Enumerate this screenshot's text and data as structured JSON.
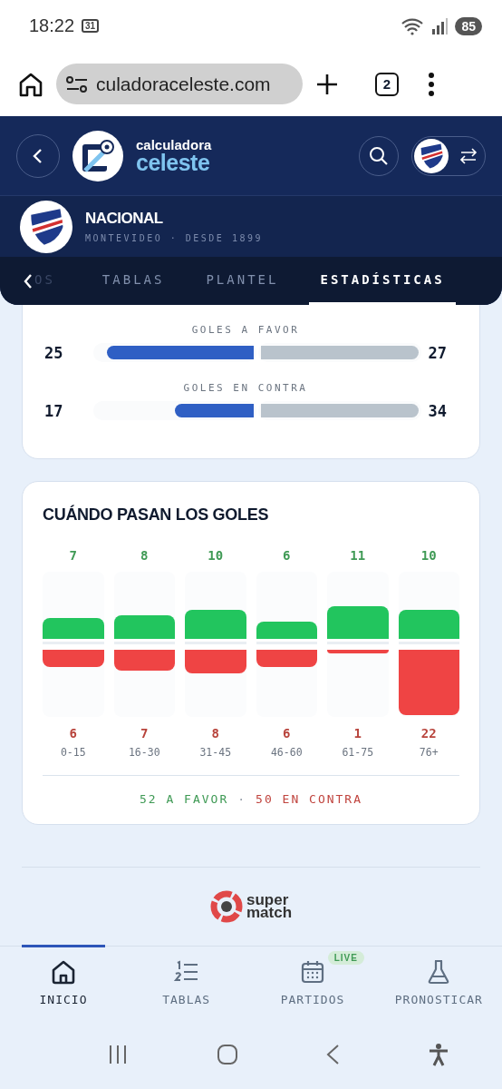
{
  "status_bar": {
    "time": "18:22",
    "calendar_day": "31",
    "battery": "85"
  },
  "browser": {
    "url": "culadoraceleste.com",
    "tab_count": "2"
  },
  "app_header": {
    "logo_top": "calculadora",
    "logo_bottom": "celeste"
  },
  "team": {
    "name": "NACIONAL",
    "subtitle": "MONTEVIDEO · DESDE 1899"
  },
  "tabs": [
    {
      "label": "OS",
      "selected": false
    },
    {
      "label": "TABLAS",
      "selected": false
    },
    {
      "label": "PLANTEL",
      "selected": false
    },
    {
      "label": "ESTADÍSTICAS",
      "selected": true
    }
  ],
  "comparisons": [
    {
      "label": "GOLES A FAVOR",
      "left": {
        "value": "25",
        "level": 0.93
      },
      "right": {
        "value": "27",
        "level": 1
      }
    },
    {
      "label": "GOLES EN CONTRA",
      "left": {
        "value": "17",
        "level": 0.5
      },
      "right": {
        "value": "34",
        "level": 1
      }
    }
  ],
  "goals_timing": {
    "title": "CUÁNDO PASAN LOS GOLES",
    "periods": [
      {
        "range": "0-15",
        "goals_for": {
          "value": "7",
          "level": 0.32
        },
        "goals_against": {
          "value": "6",
          "level": 0.27
        }
      },
      {
        "range": "16-30",
        "goals_for": {
          "value": "8",
          "level": 0.36
        },
        "goals_against": {
          "value": "7",
          "level": 0.32
        }
      },
      {
        "range": "31-45",
        "goals_for": {
          "value": "10",
          "level": 0.45
        },
        "goals_against": {
          "value": "8",
          "level": 0.36
        }
      },
      {
        "range": "46-60",
        "goals_for": {
          "value": "6",
          "level": 0.27
        },
        "goals_against": {
          "value": "6",
          "level": 0.27
        }
      },
      {
        "range": "61-75",
        "goals_for": {
          "value": "11",
          "level": 0.5
        },
        "goals_against": {
          "value": "1",
          "level": 0.05
        }
      },
      {
        "range": "76+",
        "goals_for": {
          "value": "10",
          "level": 0.45
        },
        "goals_against": {
          "value": "22",
          "level": 1
        }
      }
    ],
    "summary": [
      {
        "text": "52 A FAVOR",
        "color": "#3f9a55"
      },
      {
        "text": "50 EN CONTRA",
        "color": "#c0443e"
      }
    ],
    "separator": "·"
  },
  "sponsor": {
    "name_top": "super",
    "name_bottom": "match"
  },
  "bottom_nav": [
    {
      "label": "INICIO",
      "selected": true
    },
    {
      "label": "TABLAS",
      "selected": false
    },
    {
      "label": "PARTIDOS",
      "selected": false,
      "badge": "LIVE"
    },
    {
      "label": "PRONOSTICAR",
      "selected": false
    }
  ]
}
